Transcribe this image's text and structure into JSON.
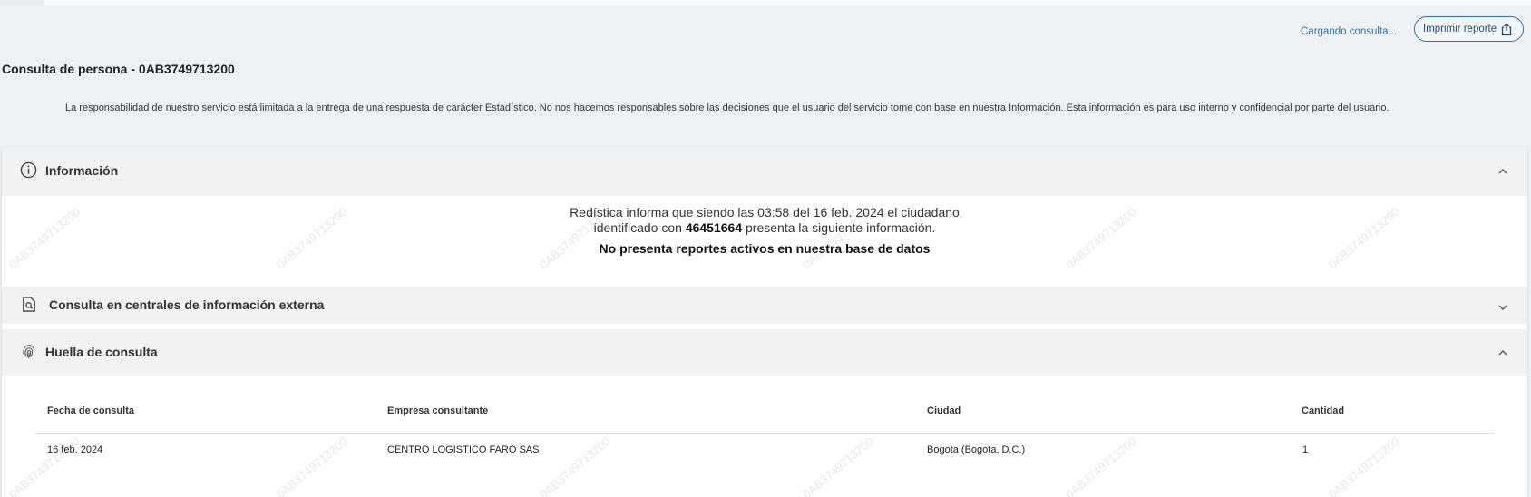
{
  "header": {
    "loading_text": "Cargando consulta...",
    "print_button_label": "Imprimir reporte",
    "print_icon": "share-icon"
  },
  "page_title": "Consulta de persona - 0AB3749713200",
  "disclaimer": "La responsabilidad de nuestro servicio está limitada a la entrega de una respuesta de carácter Estadístico. No nos hacemos responsables sobre las decisiones que el usuario del servicio tome con base en nuestra Información. Esta información es para uso interno y confidencial por parte del usuario.",
  "sections": {
    "informacion": {
      "title": "Información",
      "icon": "info-circle-icon",
      "line1": "Redística informa que siendo las 03:58 del 16 feb. 2024 el ciudadano",
      "line2_prefix": "identificado con ",
      "line2_id": "46451664",
      "line2_suffix": " presenta la siguiente información.",
      "line3": "No presenta reportes activos en nuestra base de datos"
    },
    "centrales": {
      "title": "Consulta en centrales de información externa",
      "icon": "document-search-icon"
    },
    "huella": {
      "title": "Huella de consulta",
      "icon": "fingerprint-icon",
      "columns": [
        "Fecha de consulta",
        "Empresa consultante",
        "Ciudad",
        "Cantidad"
      ],
      "rows": [
        [
          "16 feb. 2024",
          "CENTRO LOGISTICO FARO SAS",
          "Bogota (Bogota, D.C.)",
          "1"
        ]
      ]
    }
  },
  "watermark_text": "0AB3749713200",
  "colors": {
    "accent": "#2f6fa7",
    "page_bg": "#eef1f4",
    "section_header_bg": "#f2f2f2"
  }
}
